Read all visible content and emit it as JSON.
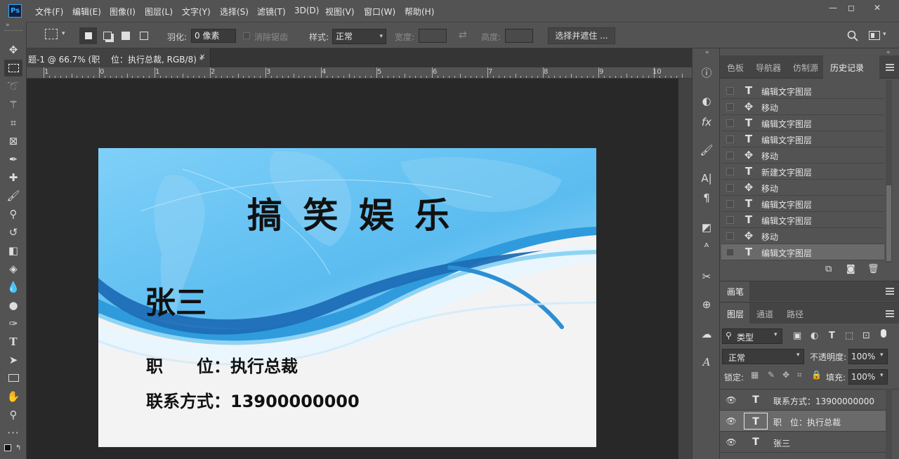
{
  "app": {
    "logo": "Ps"
  },
  "menu": [
    "文件(F)",
    "编辑(E)",
    "图像(I)",
    "图层(L)",
    "文字(Y)",
    "选择(S)",
    "滤镜(T)",
    "3D(D)",
    "视图(V)",
    "窗口(W)",
    "帮助(H)"
  ],
  "window_controls": {
    "minimize": "—",
    "restore": "◻",
    "close": "✕"
  },
  "options": {
    "feather_label": "羽化:",
    "feather_value": "0 像素",
    "antialias_label": "消除锯齿",
    "style_label": "样式:",
    "style_value": "正常",
    "width_label": "宽度:",
    "height_label": "高度:",
    "select_mask_label": "选择并遮住 ..."
  },
  "document": {
    "tab_title": "题-1 @ 66.7% (职　 位：执行总裁, RGB/8) *",
    "close": "✕",
    "ruler_labels": [
      "1",
      "0",
      "1",
      "2",
      "3",
      "4",
      "5",
      "6",
      "7",
      "8",
      "9",
      "10"
    ]
  },
  "card": {
    "company": "搞 笑 娱 乐",
    "name": "张三",
    "position": "职　　位：执行总裁",
    "contact": "联系方式：13900000000"
  },
  "panels": {
    "top_tabs": [
      "色板",
      "导航器",
      "仿制源",
      "历史记录"
    ],
    "history": [
      {
        "icon": "text-tool-icon",
        "label": "编辑文字图层"
      },
      {
        "icon": "move-tool-icon",
        "label": "移动"
      },
      {
        "icon": "text-tool-icon",
        "label": "编辑文字图层"
      },
      {
        "icon": "text-tool-icon",
        "label": "编辑文字图层"
      },
      {
        "icon": "move-tool-icon",
        "label": "移动"
      },
      {
        "icon": "text-tool-icon",
        "label": "新建文字图层"
      },
      {
        "icon": "move-tool-icon",
        "label": "移动"
      },
      {
        "icon": "text-tool-icon",
        "label": "编辑文字图层"
      },
      {
        "icon": "text-tool-icon",
        "label": "编辑文字图层"
      },
      {
        "icon": "move-tool-icon",
        "label": "移动"
      },
      {
        "icon": "text-tool-icon",
        "label": "编辑文字图层"
      }
    ],
    "brush_tab": "画笔",
    "layer_tabs": [
      "图层",
      "通道",
      "路径"
    ],
    "layer_filter": "类型",
    "blend_mode": "正常",
    "opacity_label": "不透明度:",
    "opacity_value": "100%",
    "lock_label": "锁定:",
    "fill_label": "填充:",
    "fill_value": "100%",
    "layers": [
      {
        "name": "联系方式：13900000000"
      },
      {
        "name": "职　位：执行总裁"
      },
      {
        "name": "张三"
      }
    ]
  },
  "colors": {
    "chrome": "#535353",
    "canvas_bg": "#282828",
    "card_blue": "#5cb9ee",
    "card_dark_blue": "#1b6fb5",
    "selected_row": "#6a6a6a"
  }
}
